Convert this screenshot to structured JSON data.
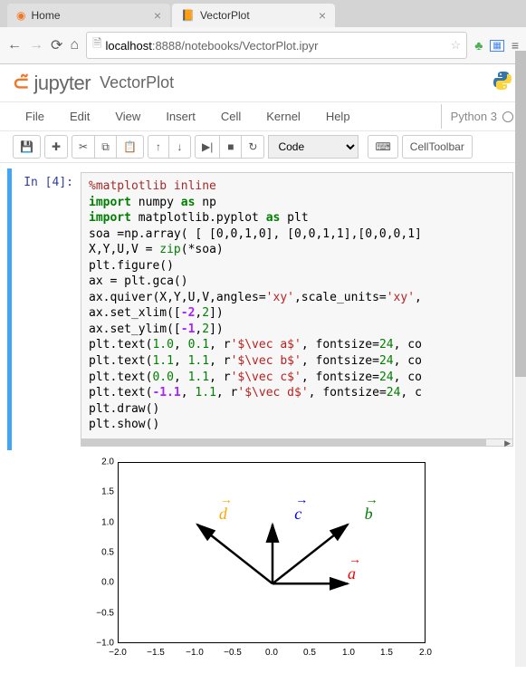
{
  "browser": {
    "tabs": [
      {
        "title": "Home",
        "favicon": "⌂"
      },
      {
        "title": "VectorPlot",
        "favicon": "📓"
      }
    ],
    "url_host": "localhost",
    "url_port": ":8888",
    "url_path": "/notebooks/VectorPlot.ipyr"
  },
  "jupyter": {
    "logo_text": "jupyter",
    "notebook_name": "VectorPlot"
  },
  "menu": {
    "items": [
      "File",
      "Edit",
      "View",
      "Insert",
      "Cell",
      "Kernel",
      "Help"
    ],
    "kernel": "Python 3"
  },
  "toolbar": {
    "save": "💾",
    "add": "✚",
    "cut": "✂",
    "copy": "⧉",
    "paste": "📋",
    "up": "↑",
    "down": "↓",
    "run": "▶|",
    "stop": "■",
    "restart": "↻",
    "celltype": "Code",
    "keyboard": "⌨",
    "celltoolbar": "CellToolbar"
  },
  "cell": {
    "prompt": "In [4]:",
    "code": {
      "l1_magic": "%matplotlib inline",
      "l2_a": "import",
      "l2_b": " numpy ",
      "l2_c": "as",
      "l2_d": " np",
      "l3_a": "import",
      "l3_b": " matplotlib.pyplot ",
      "l3_c": "as",
      "l3_d": " plt",
      "l4": "soa =np.array( [ [0,0,1,0], [0,0,1,1],[0,0,0,1]",
      "l5_a": "X,Y,U,V = ",
      "l5_b": "zip",
      "l5_c": "(*soa)",
      "l6": "plt.figure()",
      "l7": "ax = plt.gca()",
      "l8_a": "ax.quiver(X,Y,U,V,angles=",
      "l8_b": "'xy'",
      "l8_c": ",scale_units=",
      "l8_d": "'xy'",
      "l8_e": ",",
      "l9_a": "ax.set_xlim([",
      "l9_b": "-2",
      "l9_c": ",",
      "l9_d": "2",
      "l9_e": "])",
      "l10_a": "ax.set_ylim([",
      "l10_b": "-1",
      "l10_c": ",",
      "l10_d": "2",
      "l10_e": "])",
      "l11_a": "plt.text(",
      "l11_b": "1.0",
      "l11_c": ", ",
      "l11_d": "0.1",
      "l11_e": ", r",
      "l11_f": "'$\\vec a$'",
      "l11_g": ", fontsize=",
      "l11_h": "24",
      "l11_i": ", co",
      "l12_a": "plt.text(",
      "l12_b": "1.1",
      "l12_c": ", ",
      "l12_d": "1.1",
      "l12_e": ", r",
      "l12_f": "'$\\vec b$'",
      "l12_g": ", fontsize=",
      "l12_h": "24",
      "l12_i": ", co",
      "l13_a": "plt.text(",
      "l13_b": "0.0",
      "l13_c": ", ",
      "l13_d": "1.1",
      "l13_e": ", r",
      "l13_f": "'$\\vec c$'",
      "l13_g": ", fontsize=",
      "l13_h": "24",
      "l13_i": ", co",
      "l14_a": "plt.text(",
      "l14_b": "-1.1",
      "l14_c": ", ",
      "l14_d": "1.1",
      "l14_e": ", r",
      "l14_f": "'$\\vec d$'",
      "l14_g": ", fontsize=",
      "l14_h": "24",
      "l14_i": ", c",
      "l15": "plt.draw()",
      "l16": "plt.show()"
    }
  },
  "chart_data": {
    "type": "quiver",
    "title": "",
    "xlabel": "",
    "ylabel": "",
    "xlim": [
      -2,
      2
    ],
    "ylim": [
      -1,
      2
    ],
    "xticks": [
      -2.0,
      -1.5,
      -1.0,
      -0.5,
      0.0,
      0.5,
      1.0,
      1.5,
      2.0
    ],
    "yticks": [
      -1.0,
      -0.5,
      0.0,
      0.5,
      1.0,
      1.5,
      2.0
    ],
    "origin": [
      0,
      0
    ],
    "vectors": [
      {
        "name": "a",
        "u": 1,
        "v": 0,
        "label_pos": [
          1.0,
          0.1
        ],
        "color": "red"
      },
      {
        "name": "b",
        "u": 1,
        "v": 1,
        "label_pos": [
          1.1,
          1.1
        ],
        "color": "green"
      },
      {
        "name": "c",
        "u": 0,
        "v": 1,
        "label_pos": [
          0.0,
          1.1
        ],
        "color": "blue"
      },
      {
        "name": "d",
        "u": -1,
        "v": 1,
        "label_pos": [
          -1.1,
          1.1
        ],
        "color": "orange"
      }
    ],
    "ytick_labels": [
      "2.0",
      "1.5",
      "1.0",
      "0.5",
      "0.0",
      "−0.5",
      "−1.0"
    ],
    "xtick_labels": [
      "−2.0",
      "−1.5",
      "−1.0",
      "−0.5",
      "0.0",
      "0.5",
      "1.0",
      "1.5",
      "2.0"
    ],
    "vec_labels": {
      "a": "a",
      "b": "b",
      "c": "c",
      "d": "d"
    }
  }
}
